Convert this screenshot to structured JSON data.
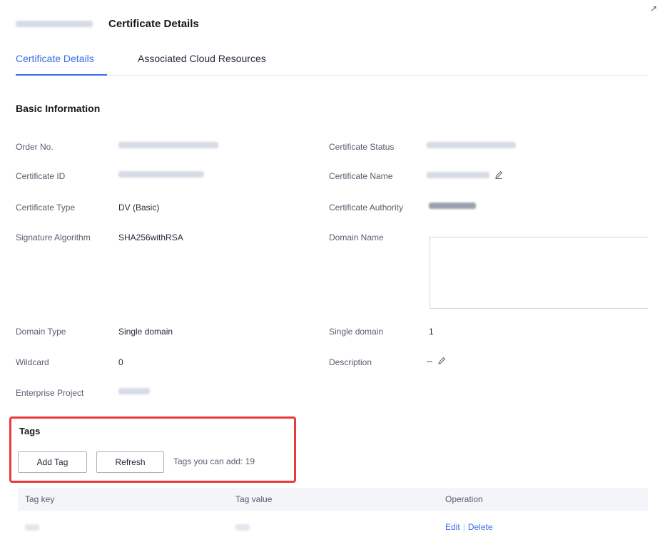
{
  "header": {
    "title": "Certificate Details"
  },
  "tabs": [
    {
      "label": "Certificate Details",
      "active": true
    },
    {
      "label": "Associated Cloud Resources",
      "active": false
    }
  ],
  "basic_info": {
    "title": "Basic Information",
    "labels": {
      "order_no": "Order No.",
      "certificate_status": "Certificate Status",
      "certificate_id": "Certificate ID",
      "certificate_name": "Certificate Name",
      "certificate_type": "Certificate Type",
      "certificate_authority": "Certificate Authority",
      "signature_algorithm": "Signature Algorithm",
      "domain_name": "Domain Name",
      "domain_type": "Domain Type",
      "single_domain": "Single domain",
      "wildcard": "Wildcard",
      "description": "Description",
      "enterprise_project": "Enterprise Project"
    },
    "values": {
      "certificate_type": "DV (Basic)",
      "signature_algorithm": "SHA256withRSA",
      "domain_type": "Single domain",
      "single_domain": "1",
      "wildcard": "0",
      "description": "--"
    }
  },
  "tags": {
    "title": "Tags",
    "add_button": "Add Tag",
    "refresh_button": "Refresh",
    "remaining": "Tags you can add: 19",
    "columns": {
      "key": "Tag key",
      "value": "Tag value",
      "operation": "Operation"
    },
    "row_actions": {
      "edit": "Edit",
      "delete": "Delete"
    }
  },
  "colors": {
    "accent": "#3a6ee5",
    "highlight": "#e83a3a"
  },
  "icons": {
    "edit": "pencil-icon",
    "expand": "arrow-expand-icon"
  }
}
